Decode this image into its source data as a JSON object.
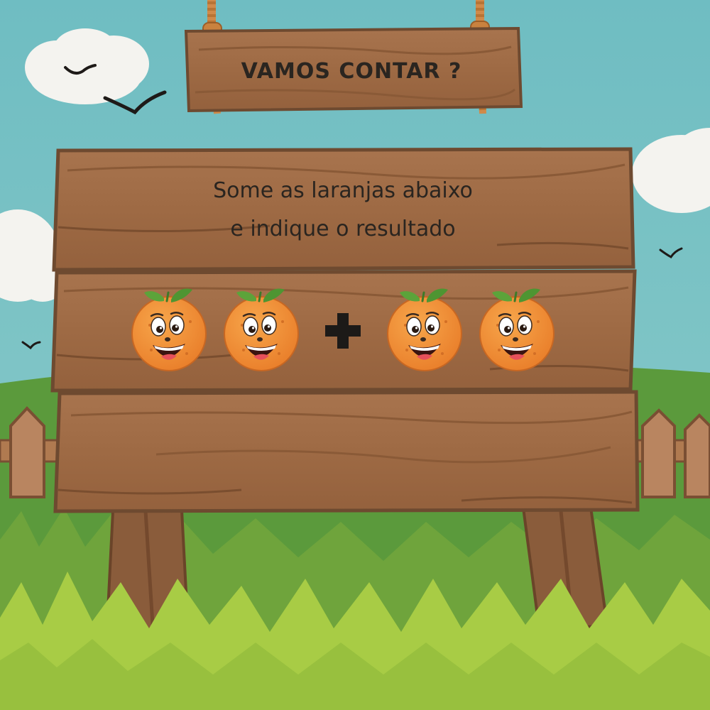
{
  "title_sign": {
    "text": "VAMOS CONTAR ?"
  },
  "instruction_sign": {
    "line1": "Some as laranjas abaixo",
    "line2": "e indique o resultado"
  },
  "equation": {
    "left_group_count": 2,
    "operator": "+",
    "right_group_count": 2,
    "item_icon": "smiling-orange-icon"
  },
  "answer_sign": {
    "value": ""
  },
  "colors": {
    "sky": "#7CC3C7",
    "wood": "#A06C46",
    "wood_dark": "#6E4A30",
    "orange": "#F0913A",
    "leaf": "#5CA33A",
    "grass_light": "#A8CC45",
    "grass_dark": "#6FA43C"
  }
}
